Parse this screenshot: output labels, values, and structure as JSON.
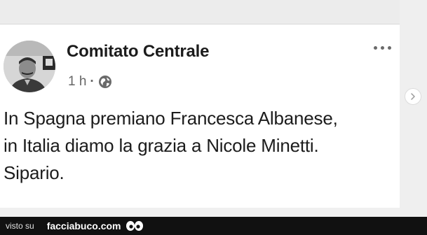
{
  "post": {
    "author": "Comitato Centrale",
    "time": "1 h",
    "separator": "·",
    "privacy_icon": "globe-icon",
    "more_icon": "more-horizontal-icon",
    "text_lines": [
      "In Spagna premiano Francesca Albanese,",
      "in Italia diamo la grazia a Nicole Minetti.",
      "Sipario."
    ]
  },
  "navigation": {
    "next_icon": "chevron-right-icon"
  },
  "footer": {
    "prefix": "visto su",
    "site": "facciabuco.com",
    "logo_icon": "eyes-icon"
  },
  "colors": {
    "card_bg": "#ffffff",
    "page_bg": "#f0f0f0",
    "footer_bg": "#111111",
    "text": "#1c1c1c",
    "meta": "#666666"
  }
}
